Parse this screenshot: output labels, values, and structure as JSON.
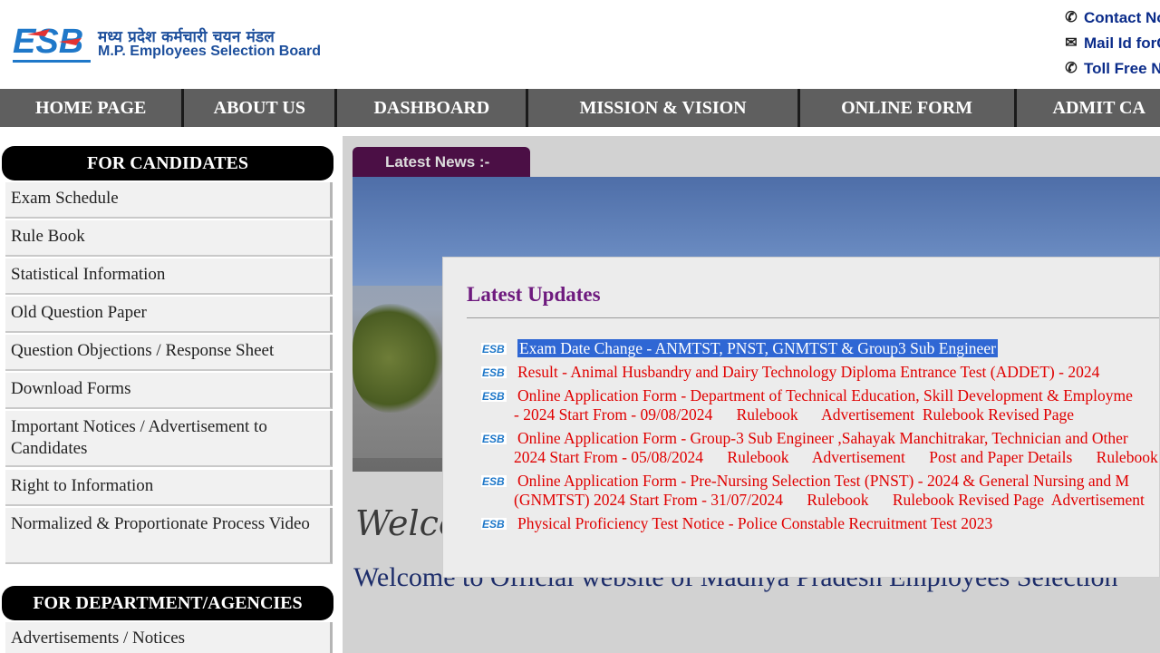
{
  "header": {
    "org_name_hindi": "मध्य प्रदेश कर्मचारी चयन मंडल",
    "org_name_english": "M.P. Employees Selection Board",
    "logo_text": "ESB",
    "contact": [
      {
        "icon": "phone-icon",
        "text": "Contact No."
      },
      {
        "icon": "mail-icon",
        "text": "Mail Id forC"
      },
      {
        "icon": "phone-icon",
        "text": "Toll Free No"
      }
    ]
  },
  "nav": {
    "items": [
      "HOME PAGE",
      "ABOUT US",
      "DASHBOARD",
      "MISSION & VISION",
      "ONLINE FORM",
      "ADMIT CA"
    ]
  },
  "sidebar": {
    "candidates_heading": "FOR CANDIDATES",
    "candidate_items": [
      "Exam Schedule",
      "Rule Book",
      "Statistical Information",
      "Old Question Paper",
      "Question Objections / Response Sheet",
      "Download Forms",
      "Important Notices / Advertisement to Candidates",
      "Right to Information",
      "Normalized & Proportionate Process Video"
    ],
    "department_heading": "FOR DEPARTMENT/AGENCIES",
    "department_items": [
      "Advertisements / Notices"
    ]
  },
  "main": {
    "news_tab": "Latest News :-",
    "welcome_script": "Welco",
    "welcome_text": "Welcome to Official website of Madhya Pradesh Employees Selection"
  },
  "popup": {
    "title": "Latest Updates",
    "updates": [
      {
        "line1": "Exam Date Change - ANMTST, PNST, GNMTST & Group3 Sub Engineer",
        "highlighted": true
      },
      {
        "line1": "Result - Animal Husbandry and Dairy Technology Diploma Entrance Test (ADDET) - 2024"
      },
      {
        "line1": "Online Application Form - Department of Technical Education, Skill Development & Employme",
        "line2": "- 2024 Start From - 09/08/2024",
        "links": [
          "Rulebook",
          "Advertisement",
          "Rulebook Revised Page"
        ]
      },
      {
        "line1": "Online Application Form - Group-3 Sub Engineer ,Sahayak Manchitrakar, Technician and Other",
        "line2": "2024 Start From - 05/08/2024",
        "links": [
          "Rulebook",
          "Advertisement",
          "Post and Paper Details",
          "Rulebook"
        ]
      },
      {
        "line1": "Online Application Form - Pre-Nursing Selection Test (PNST) - 2024 & General Nursing and M",
        "line2": "(GNMTST) 2024 Start From - 31/07/2024",
        "links": [
          "Rulebook",
          "Rulebook Revised Page",
          "Advertisement"
        ]
      },
      {
        "line1": "Physical Proficiency Test Notice - Police Constable Recruitment Test 2023"
      }
    ]
  },
  "colors": {
    "nav_bg": "#5f5f5f",
    "brand_blue": "#1d4f9c",
    "update_red": "#e00000",
    "title_purple": "#6e1a7e",
    "news_tab_bg": "#4b0f45"
  }
}
